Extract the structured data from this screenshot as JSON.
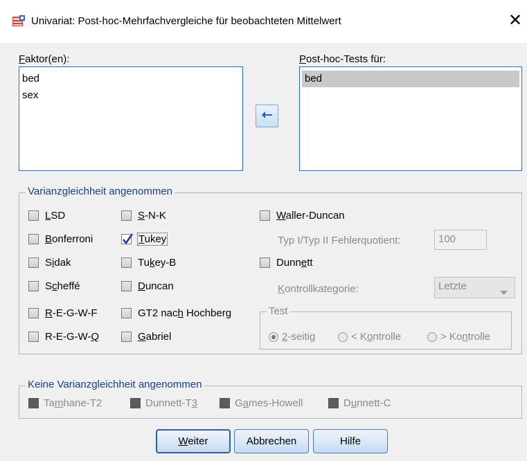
{
  "window": {
    "title": "Univariat: Post-hoc-Mehrfachvergleiche für beobachteten Mittelwert",
    "close_symbol": "✕"
  },
  "factors": {
    "label": "Faktor(en):",
    "items": [
      "bed",
      "sex"
    ]
  },
  "posthoc": {
    "label": "Post-hoc-Tests für:",
    "items": [
      "bed"
    ]
  },
  "equal_variance": {
    "legend": "Varianzgleichheit angenommen",
    "col1": [
      {
        "label": "LSD",
        "checked": false
      },
      {
        "label": "Bonferroni",
        "checked": false
      },
      {
        "label": "Sidak",
        "checked": false
      },
      {
        "label": "Scheffé",
        "checked": false
      },
      {
        "label": "R-E-G-W-F",
        "checked": false
      },
      {
        "label": "R-E-G-W-Q",
        "checked": false
      }
    ],
    "col2": [
      {
        "label": "S-N-K",
        "checked": false
      },
      {
        "label": "Tukey",
        "checked": true
      },
      {
        "label": "Tukey-B",
        "checked": false
      },
      {
        "label": "Duncan",
        "checked": false
      },
      {
        "label": "GT2 nach Hochberg",
        "checked": false
      },
      {
        "label": "Gabriel",
        "checked": false
      }
    ],
    "waller_duncan": "Waller-Duncan",
    "error_ratio_label": "Typ I/Typ II Fehlerquotient:",
    "error_ratio_value": "100",
    "dunnett": "Dunnett",
    "control_label": "Kontrollkategorie:",
    "control_value": "Letzte",
    "test_legend": "Test",
    "test_options": [
      "2-seitig",
      "< Kontrolle",
      "> Kontrolle"
    ]
  },
  "unequal_variance": {
    "legend": "Keine Varianzgleichheit angenommen",
    "options": [
      "Tamhane-T2",
      "Dunnett-T3",
      "Games-Howell",
      "Dunnett-C"
    ]
  },
  "buttons": {
    "continue": "Weiter",
    "cancel": "Abbrechen",
    "help": "Hilfe"
  }
}
